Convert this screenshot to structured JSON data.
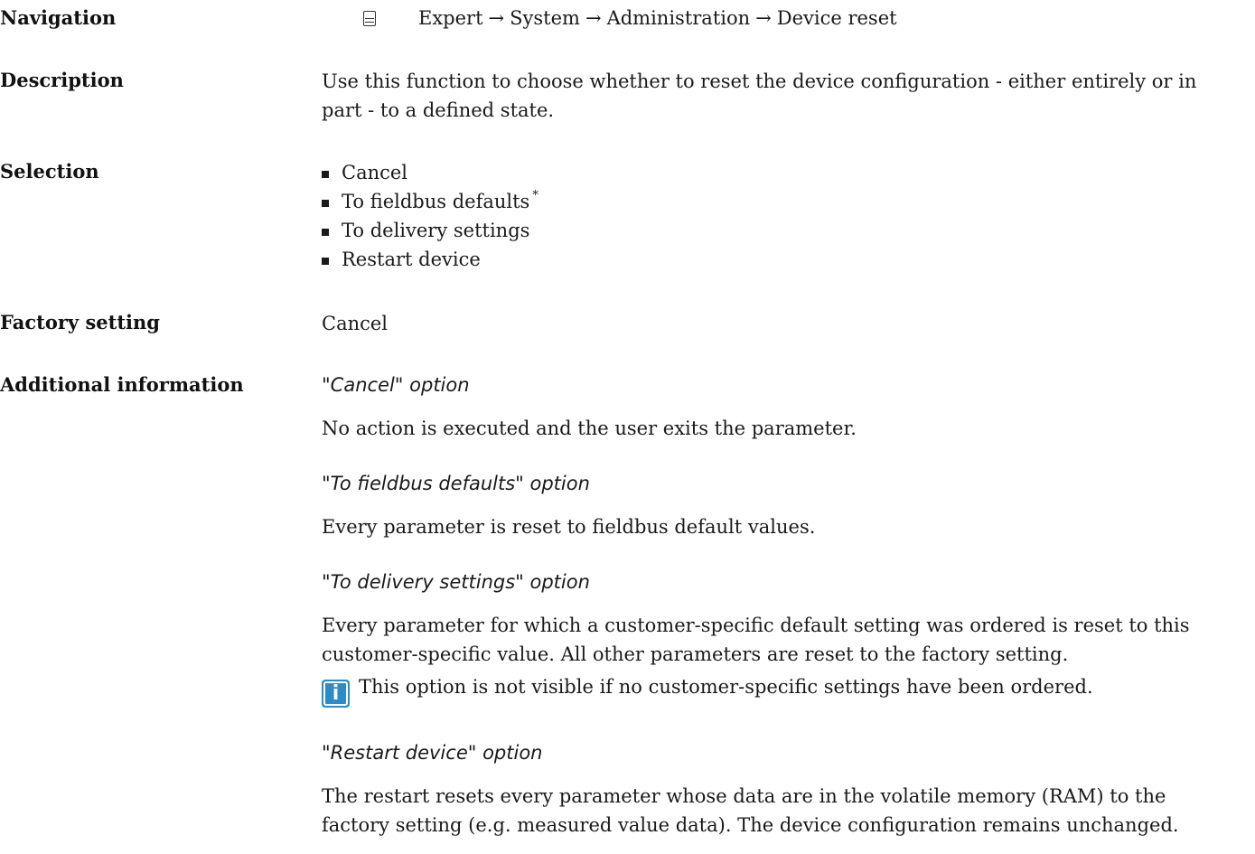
{
  "navigation": {
    "label": "Navigation",
    "icon": "display-icon",
    "path": [
      "Expert",
      "System",
      "Administration",
      "Device reset"
    ],
    "arrow": "→"
  },
  "description": {
    "label": "Description",
    "lines": [
      "Use this function to choose whether to reset the device configuration - either entirely or in",
      "part - to a defined state."
    ]
  },
  "selection": {
    "label": "Selection",
    "items": [
      {
        "text": "Cancel",
        "marker": ""
      },
      {
        "text": "To fieldbus defaults",
        "marker": "*"
      },
      {
        "text": "To delivery settings",
        "marker": ""
      },
      {
        "text": "Restart device",
        "marker": ""
      }
    ]
  },
  "factory_setting": {
    "label": "Factory setting",
    "value": "Cancel"
  },
  "additional_information": {
    "label": "Additional information",
    "options": [
      {
        "title": "\"Cancel\" option",
        "lines": [
          "No action is executed and the user exits the parameter."
        ]
      },
      {
        "title": "\"To fieldbus defaults\" option",
        "lines": [
          "Every parameter is reset to fieldbus default values."
        ]
      },
      {
        "title": "\"To delivery settings\" option",
        "lines": [
          "Every parameter for which a customer-specific default setting was ordered is reset to this",
          "customer-specific value. All other parameters are reset to the factory setting."
        ],
        "note": {
          "icon": "info-icon",
          "icon_glyph": "i",
          "text": "This option is not visible if no customer-specific settings have been ordered."
        }
      },
      {
        "title": "\"Restart device\" option",
        "lines": [
          "The restart resets every parameter whose data are in the volatile memory (RAM) to the",
          "factory setting (e.g. measured value data). The device configuration remains unchanged."
        ]
      }
    ]
  },
  "colors": {
    "text": "#1a1a1a",
    "info_icon": "#2e8bc9"
  }
}
